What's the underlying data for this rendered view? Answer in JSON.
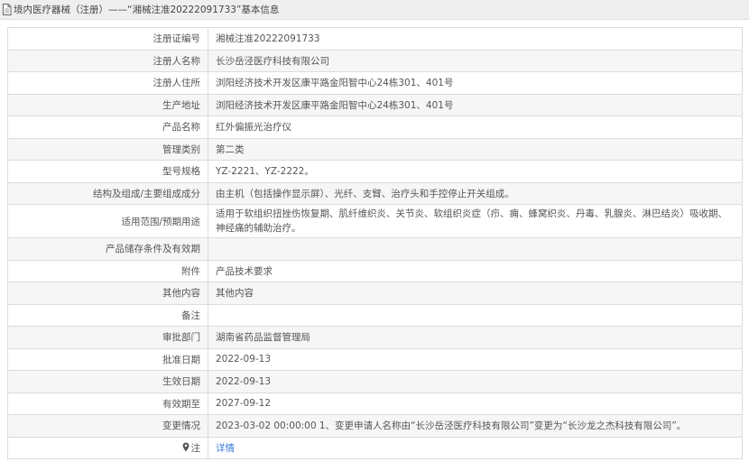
{
  "header": {
    "title": "境内医疗器械（注册）——“湘械注准20222091733”基本信息",
    "icon": "document-icon"
  },
  "rows": [
    {
      "label": "注册证编号",
      "value": "湘械注准20222091733"
    },
    {
      "label": "注册人名称",
      "value": "长沙岳泾医疗科技有限公司"
    },
    {
      "label": "注册人住所",
      "value": "浏阳经济技术开发区康平路金阳智中心24栋301、401号"
    },
    {
      "label": "生产地址",
      "value": "浏阳经济技术开发区康平路金阳智中心24栋301、401号"
    },
    {
      "label": "产品名称",
      "value": "红外偏振光治疗仪"
    },
    {
      "label": "管理类别",
      "value": "第二类"
    },
    {
      "label": "型号规格",
      "value": "YZ-2221、YZ-2222。"
    },
    {
      "label": "结构及组成/主要组成成分",
      "value": "由主机（包括操作显示屏）、光纤、支臂、治疗头和手控停止开关组成。"
    },
    {
      "label": "适用范围/预期用途",
      "value": "适用于软组织扭挫伤恢复期、肌纤维织炎、关节炎、软组织炎症（疖、痈、蜂窝织炎、丹毒、乳腺炎、淋巴结炎）吸收期、神经痛的辅助治疗。"
    },
    {
      "label": "产品储存条件及有效期",
      "value": ""
    },
    {
      "label": "附件",
      "value": "产品技术要求"
    },
    {
      "label": "其他内容",
      "value": "其他内容"
    },
    {
      "label": "备注",
      "value": ""
    },
    {
      "label": "审批部门",
      "value": "湖南省药品监督管理局"
    },
    {
      "label": "批准日期",
      "value": "2022-09-13"
    },
    {
      "label": "生效日期",
      "value": "2022-09-13"
    },
    {
      "label": "有效期至",
      "value": "2027-09-12"
    },
    {
      "label": "变更情况",
      "value": "2023-03-02 00:00:00 1、变更申请人名称由“长沙岳泾医疗科技有限公司”变更为“长沙龙之杰科技有限公司”。"
    }
  ],
  "detail": {
    "label": "注",
    "icon": "location-pin-icon",
    "link_text": "详情"
  },
  "colors": {
    "link": "#3a7bd5",
    "header_bg": "#efefef",
    "border": "#dcdcdc",
    "stripe": "#f6f6f6"
  }
}
